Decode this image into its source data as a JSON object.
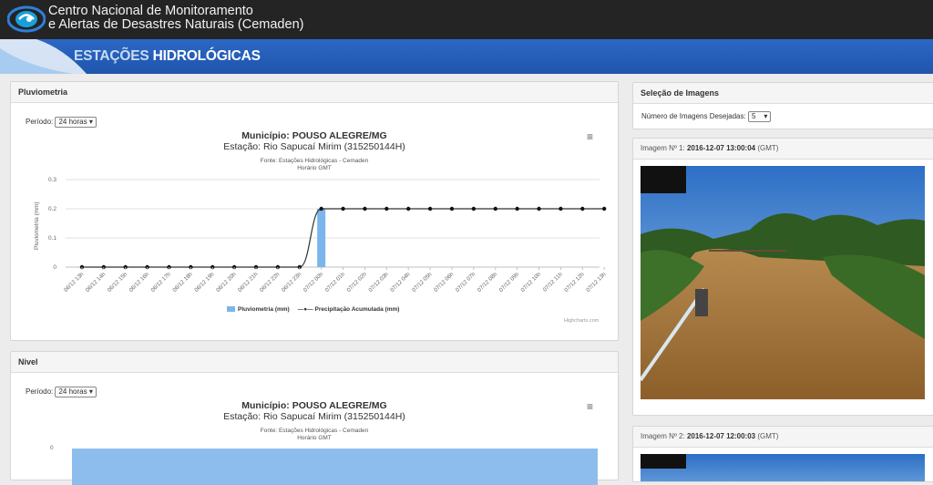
{
  "header": {
    "org_line1": "Centro Nacional de Monitoramento",
    "org_line2": "e Alertas de Desastres Naturais (Cemaden)"
  },
  "banner": {
    "title_part1": "ESTAÇÕES",
    "title_part2": "HIDROLÓGICAS"
  },
  "pluviometria_panel": {
    "title": "Pluviometria",
    "periodo_label": "Período:",
    "periodo_value": "24 horas",
    "chart_title_label": "Município:",
    "chart_title_value": "POUSO ALEGRE/MG",
    "chart_subtitle": "Estação: Rio Sapucaí Mirim (315250144H)",
    "source_line1": "Fonte: Estações Hidrológicas - Cemaden",
    "source_line2": "Horário GMT",
    "ylabel": "Pluviometria (mm)",
    "menu_icon": "hamburger-menu-icon",
    "credits": "Highcharts.com"
  },
  "nivel_panel": {
    "title": "Nivel",
    "periodo_label": "Período:",
    "periodo_value": "24 horas",
    "chart_title_label": "Município:",
    "chart_title_value": "POUSO ALEGRE/MG",
    "chart_subtitle": "Estação: Rio Sapucaí Mirim (315250144H)",
    "source_line1": "Fonte: Estações Hidrológicas - Cemaden",
    "source_line2": "Horário GMT",
    "ytick_top": "0",
    "menu_icon": "hamburger-menu-icon"
  },
  "images_panel": {
    "title": "Seleção de Imagens",
    "count_label": "Número de Imagens Desejadas:",
    "count_value": "5"
  },
  "images": [
    {
      "label": "Imagem Nº 1:",
      "datetime": "2016-12-07 13:00:04",
      "tz": "(GMT)"
    },
    {
      "label": "Imagem Nº 2:",
      "datetime": "2016-12-07 12:00:03",
      "tz": "(GMT)"
    }
  ],
  "colors": {
    "bar": "#7cb5ec",
    "line": "#333333",
    "banner": "#2563bf"
  },
  "chart_data": [
    {
      "type": "bar",
      "title": "Município: POUSO ALEGRE/MG",
      "subtitle": "Estação: Rio Sapucaí Mirim (315250144H)",
      "ylabel": "Pluviometria (mm)",
      "ylim": [
        0,
        0.3
      ],
      "yticks": [
        "0",
        "0.1",
        "0.2",
        "0.3"
      ],
      "grid": true,
      "legend_position": "bottom",
      "categories": [
        "06/12 13h",
        "06/12 14h",
        "06/12 15h",
        "06/12 16h",
        "06/12 17h",
        "06/12 18h",
        "06/12 19h",
        "06/12 20h",
        "06/12 21h",
        "06/12 22h",
        "06/12 23h",
        "07/12 00h",
        "07/12 01h",
        "07/12 02h",
        "07/12 03h",
        "07/12 04h",
        "07/12 05h",
        "07/12 06h",
        "07/12 07h",
        "07/12 08h",
        "07/12 09h",
        "07/12 10h",
        "07/12 11h",
        "07/12 12h",
        "07/12 13h"
      ],
      "series": [
        {
          "name": "Pluviometria (mm)",
          "type": "bar",
          "values": [
            0,
            0,
            0,
            0,
            0,
            0,
            0,
            0,
            0,
            0,
            0,
            0.2,
            0,
            0,
            0,
            0,
            0,
            0,
            0,
            0,
            0,
            0,
            0,
            0,
            0
          ]
        },
        {
          "name": "Precipitação Acumulada (mm)",
          "type": "line",
          "values": [
            0,
            0,
            0,
            0,
            0,
            0,
            0,
            0,
            0,
            0,
            0,
            0.2,
            0.2,
            0.2,
            0.2,
            0.2,
            0.2,
            0.2,
            0.2,
            0.2,
            0.2,
            0.2,
            0.2,
            0.2,
            0.2
          ]
        }
      ]
    }
  ]
}
